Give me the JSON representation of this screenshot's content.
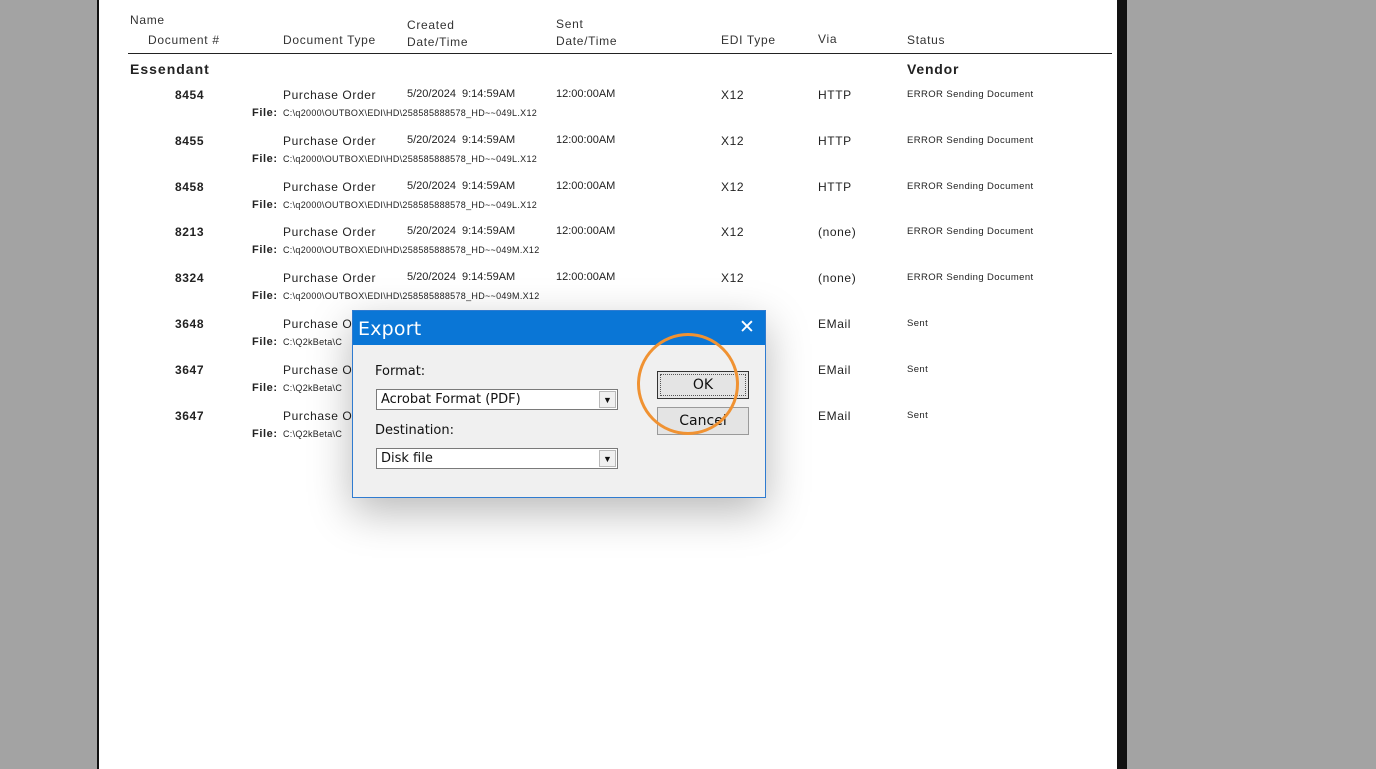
{
  "report": {
    "header": {
      "name": "Name",
      "document_num": "Document #",
      "document_type": "Document Type",
      "created": "Created",
      "created_datetime": "Date/Time",
      "sent": "Sent",
      "sent_datetime": "Date/Time",
      "edi_type": "EDI Type",
      "via": "Via",
      "status": "Status"
    },
    "group": {
      "name": "Essendant",
      "role": "Vendor"
    },
    "file_label": "File:",
    "rows": [
      {
        "doc": "8454",
        "type": "Purchase Order",
        "created": "5/20/2024  9:14:59AM",
        "sent": "12:00:00AM",
        "edi": "X12",
        "via": "HTTP",
        "status": "ERROR Sending Document",
        "file": "C:\\q2000\\OUTBOX\\EDI\\HD\\258585888578_HD~~049L.X12"
      },
      {
        "doc": "8455",
        "type": "Purchase Order",
        "created": "5/20/2024  9:14:59AM",
        "sent": "12:00:00AM",
        "edi": "X12",
        "via": "HTTP",
        "status": "ERROR Sending Document",
        "file": "C:\\q2000\\OUTBOX\\EDI\\HD\\258585888578_HD~~049L.X12"
      },
      {
        "doc": "8458",
        "type": "Purchase Order",
        "created": "5/20/2024  9:14:59AM",
        "sent": "12:00:00AM",
        "edi": "X12",
        "via": "HTTP",
        "status": "ERROR Sending Document",
        "file": "C:\\q2000\\OUTBOX\\EDI\\HD\\258585888578_HD~~049L.X12"
      },
      {
        "doc": "8213",
        "type": "Purchase Order",
        "created": "5/20/2024  9:14:59AM",
        "sent": "12:00:00AM",
        "edi": "X12",
        "via": "(none)",
        "status": "ERROR Sending Document",
        "file": "C:\\q2000\\OUTBOX\\EDI\\HD\\258585888578_HD~~049M.X12"
      },
      {
        "doc": "8324",
        "type": "Purchase Order",
        "created": "5/20/2024  9:14:59AM",
        "sent": "12:00:00AM",
        "edi": "X12",
        "via": "(none)",
        "status": "ERROR Sending Document",
        "file": "C:\\q2000\\OUTBOX\\EDI\\HD\\258585888578_HD~~049M.X12"
      },
      {
        "doc": "3648",
        "type": "Purchase O",
        "created": "",
        "sent": "",
        "edi": "",
        "via": "EMail",
        "status": "Sent",
        "file": "C:\\Q2kBeta\\C"
      },
      {
        "doc": "3647",
        "type": "Purchase O",
        "created": "",
        "sent": "",
        "edi": "",
        "via": "EMail",
        "status": "Sent",
        "file": "C:\\Q2kBeta\\C"
      },
      {
        "doc": "3647",
        "type": "Purchase O",
        "created": "",
        "sent": "",
        "edi": "",
        "via": "EMail",
        "status": "Sent",
        "file": "C:\\Q2kBeta\\C"
      }
    ]
  },
  "dialog": {
    "title": "Export",
    "close_glyph": "✕",
    "format_label": "Format:",
    "format_value": "Acrobat Format (PDF)",
    "destination_label": "Destination:",
    "destination_value": "Disk file",
    "dropdown_glyph": "▼",
    "ok_label": "OK",
    "cancel_label": "Cancel"
  },
  "colors": {
    "highlight": "#f09232",
    "titlebar": "#0a76d6"
  }
}
